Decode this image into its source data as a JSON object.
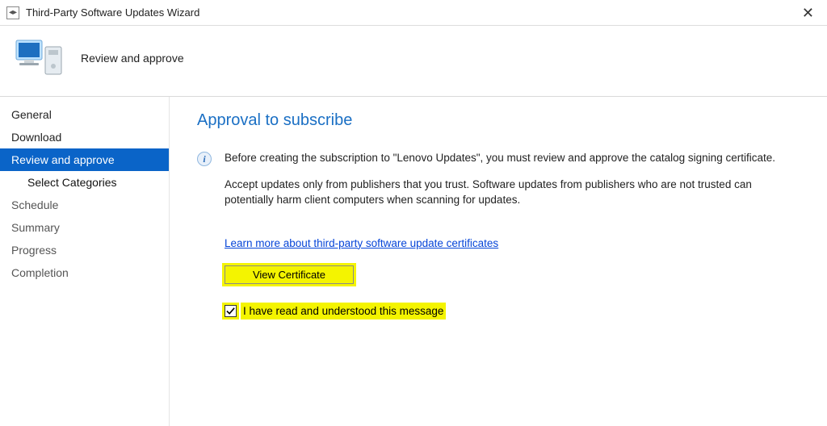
{
  "window": {
    "title": "Third-Party Software Updates Wizard"
  },
  "header": {
    "step_title": "Review and approve"
  },
  "sidebar": {
    "items": [
      {
        "label": "General"
      },
      {
        "label": "Download"
      },
      {
        "label": "Review and approve"
      },
      {
        "label": "Select Categories"
      },
      {
        "label": "Schedule"
      },
      {
        "label": "Summary"
      },
      {
        "label": "Progress"
      },
      {
        "label": "Completion"
      }
    ]
  },
  "content": {
    "heading": "Approval to subscribe",
    "info_p1": "Before creating the subscription to \"Lenovo Updates\", you must review and approve the catalog signing certificate.",
    "info_p2": "Accept updates only from publishers that you trust. Software updates from publishers who are not trusted can potentially harm client computers when scanning for updates.",
    "learn_link": "Learn more about third-party software update certificates",
    "view_cert_label": "View Certificate",
    "checkbox_label": "I have read and understood this message",
    "checkbox_checked": true
  }
}
